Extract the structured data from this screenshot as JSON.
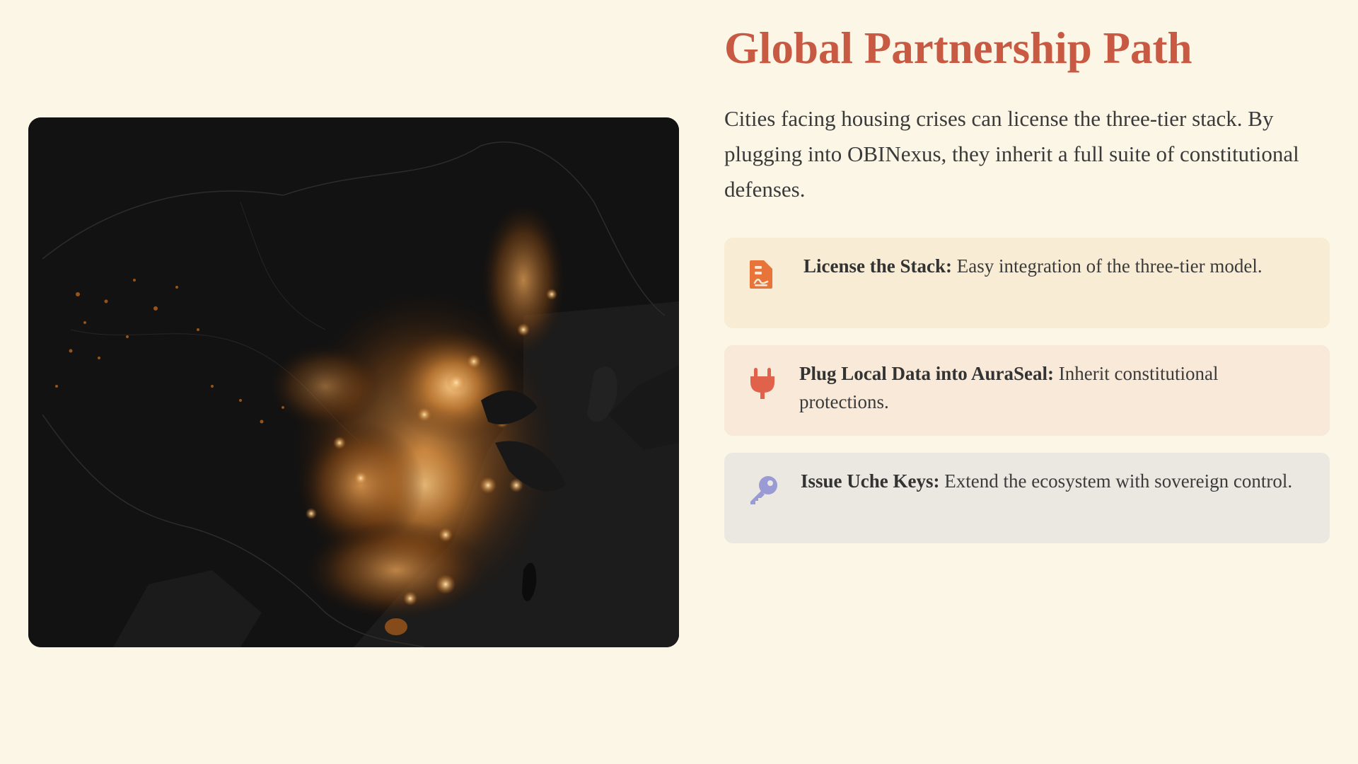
{
  "header": {
    "title": "Global Partnership Path"
  },
  "intro": {
    "text": "Cities facing housing crises can license the three-tier stack. By plugging into OBINexus, they inherit a full suite of constitutional defenses."
  },
  "map": {
    "icon": "night-lights-map-image"
  },
  "cards": [
    {
      "icon": "file-document-icon",
      "icon_color": "#e8743a",
      "bg": "#f9ecd4",
      "bold": "License the Stack:",
      "text": " Easy integration of the three-tier model."
    },
    {
      "icon": "plug-icon",
      "icon_color": "#e0624a",
      "bg": "#f8e9d8",
      "bold": "Plug Local Data into AuraSeal:",
      "text": " Inherit constitutional protections."
    },
    {
      "icon": "key-icon",
      "icon_color": "#9a9ad4",
      "bg": "#ebe7e1",
      "bold": "Issue Uche Keys:",
      "text": " Extend the ecosystem with sovereign control."
    }
  ],
  "colors": {
    "background": "#fcf6e6",
    "title": "#c85a44",
    "body_text": "#3a3a3a"
  }
}
